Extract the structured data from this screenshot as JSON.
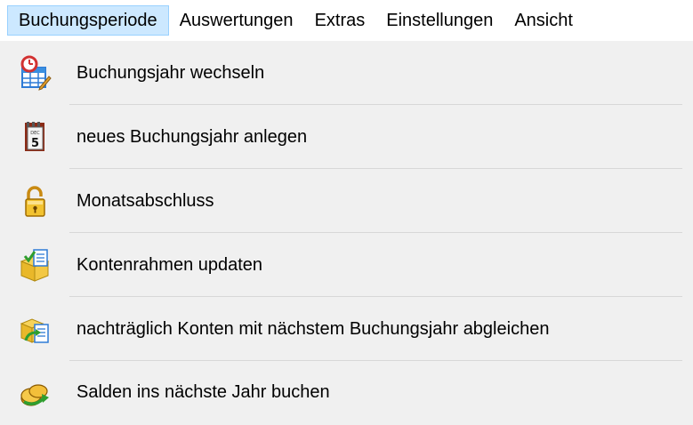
{
  "menubar": {
    "menus": [
      "Buchungsperiode",
      "Auswertungen",
      "Extras",
      "Einstellungen",
      "Ansicht"
    ]
  },
  "dropdown": {
    "items": [
      {
        "label": "Buchungsjahr wechseln",
        "icon": "calendar-grid-pencil-icon"
      },
      {
        "label": "neues Buchungsjahr anlegen",
        "icon": "calendar-page-icon"
      },
      {
        "label": "Monatsabschluss",
        "icon": "padlock-icon"
      },
      {
        "label": "Kontenrahmen updaten",
        "icon": "folder-update-icon"
      },
      {
        "label": "nachträglich Konten mit nächstem Buchungsjahr abgleichen",
        "icon": "folder-transfer-icon"
      },
      {
        "label": "Salden ins nächste Jahr buchen",
        "icon": "coin-transfer-icon"
      }
    ]
  }
}
